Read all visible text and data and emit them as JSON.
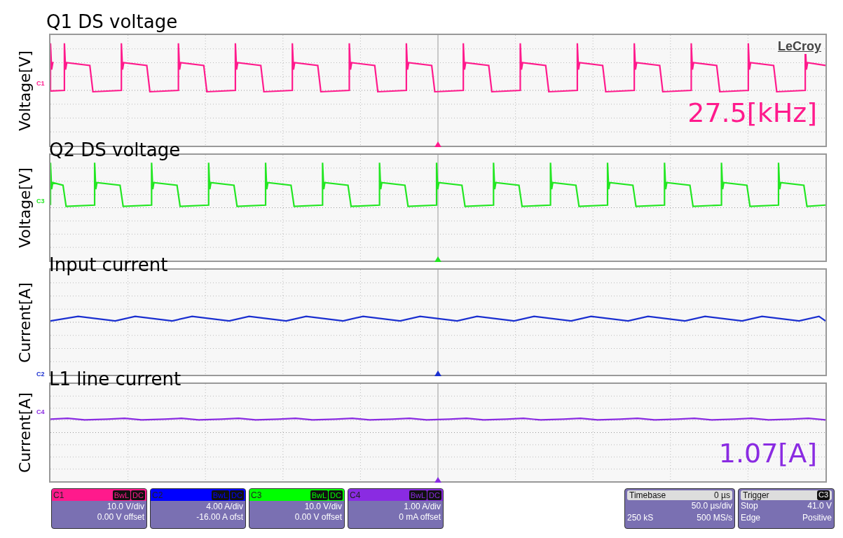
{
  "traces": [
    {
      "title": "Q1 DS voltage",
      "ylabel": "Voltage[V]",
      "channel": "C1",
      "color": "#ff1a8c",
      "kind": "square",
      "logo": "LeCroy",
      "reading": "27.5[kHz]"
    },
    {
      "title": "Q2 DS voltage",
      "ylabel": "Voltage[V]",
      "channel": "C3",
      "color": "#22e622",
      "kind": "square"
    },
    {
      "title": "Input current",
      "ylabel": "Current[A]",
      "channel": "C2",
      "color": "#1a2fd0",
      "kind": "ripple"
    },
    {
      "title": "L1 line current",
      "ylabel": "Current[A]",
      "channel": "C4",
      "color": "#8a2be2",
      "kind": "flat",
      "reading": "1.07[A]"
    }
  ],
  "channels": [
    {
      "name": "C1",
      "color": "#ff1a8c",
      "bandwidth": "BwL",
      "coupling": "DC",
      "scale": "10.0 V/div",
      "offset": "0.00 V offset"
    },
    {
      "name": "C2",
      "color": "#0000ff",
      "bandwidth": "BwL",
      "coupling": "DC",
      "scale": "4.00 A/div",
      "offset": "-16.00 A ofst"
    },
    {
      "name": "C3",
      "color": "#00ff00",
      "bandwidth": "BwL",
      "coupling": "DC",
      "scale": "10.0 V/div",
      "offset": "0.00 V offset"
    },
    {
      "name": "C4",
      "color": "#8a2be2",
      "bandwidth": "BwL",
      "coupling": "DC",
      "scale": "1.00 A/div",
      "offset": "0 mA offset"
    }
  ],
  "timebase": {
    "label": "Timebase",
    "delay": "0 µs",
    "scale": "50.0 µs/div",
    "samples": "250 kS",
    "rate": "500 MS/s"
  },
  "trigger": {
    "label": "Trigger",
    "source": "C3",
    "mode": "Stop",
    "voltage": "41.0 V",
    "type": "Edge",
    "slope": "Positive"
  }
}
